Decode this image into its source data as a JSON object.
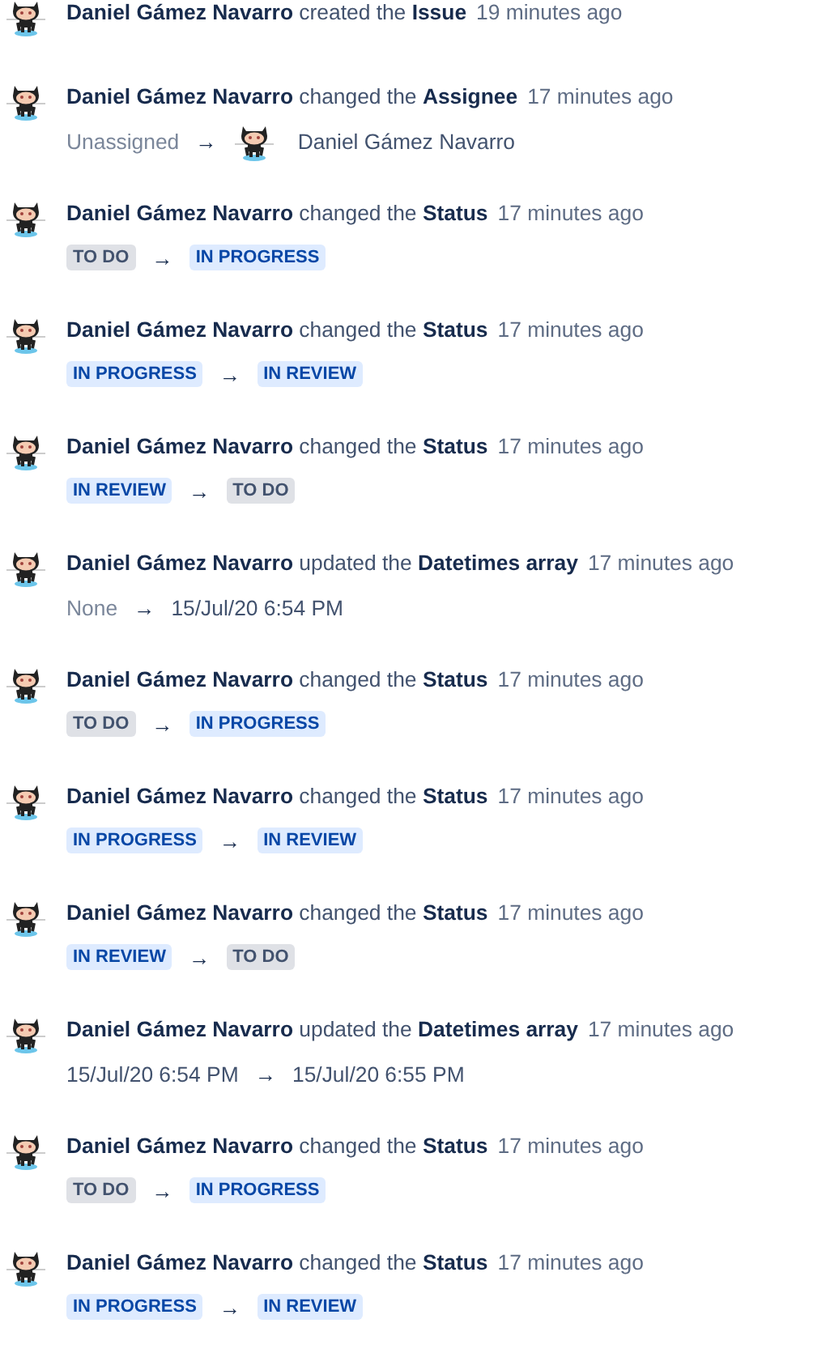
{
  "history": [
    {
      "summary": "**Daniel Gámez Navarro** created the **Issue**",
      "time": "19 minutes ago"
    },
    {
      "summary": "**Daniel Gámez Navarro** changed the **Assignee**",
      "time": "17 minutes ago",
      "from": {
        "kind": "text",
        "text": "Unassigned",
        "muted": true
      },
      "to": {
        "kind": "user",
        "text": "Daniel Gámez Navarro"
      }
    },
    {
      "summary": "**Daniel Gámez Navarro** changed the **Status**",
      "time": "17 minutes ago",
      "from": {
        "kind": "status",
        "text": "TO DO",
        "color": "#dfe1e6"
      },
      "to": {
        "kind": "status",
        "text": "IN PROGRESS",
        "color": "#deebff"
      }
    },
    {
      "summary": "**Daniel Gámez Navarro** changed the **Status**",
      "time": "17 minutes ago",
      "from": {
        "kind": "status",
        "text": "IN PROGRESS",
        "color": "#deebff"
      },
      "to": {
        "kind": "status",
        "text": "IN REVIEW",
        "color": "#deebff"
      }
    },
    {
      "summary": "**Daniel Gámez Navarro** changed the **Status**",
      "time": "17 minutes ago",
      "from": {
        "kind": "status",
        "text": "IN REVIEW",
        "color": "#deebff"
      },
      "to": {
        "kind": "status",
        "text": "TO DO",
        "color": "#dfe1e6"
      }
    },
    {
      "summary": "**Daniel Gámez Navarro** updated the **Datetimes array**",
      "time": "17 minutes ago",
      "from": {
        "kind": "text",
        "text": "None",
        "muted": true
      },
      "to": {
        "kind": "text",
        "text": "15/Jul/20 6:54 PM",
        "muted": false
      }
    },
    {
      "summary": "**Daniel Gámez Navarro** changed the **Status**",
      "time": "17 minutes ago",
      "from": {
        "kind": "status",
        "text": "TO DO",
        "color": "#dfe1e6"
      },
      "to": {
        "kind": "status",
        "text": "IN PROGRESS",
        "color": "#deebff"
      }
    },
    {
      "summary": "**Daniel Gámez Navarro** changed the **Status**",
      "time": "17 minutes ago",
      "from": {
        "kind": "status",
        "text": "IN PROGRESS",
        "color": "#deebff"
      },
      "to": {
        "kind": "status",
        "text": "IN REVIEW",
        "color": "#deebff"
      }
    },
    {
      "summary": "**Daniel Gámez Navarro** changed the **Status**",
      "time": "17 minutes ago",
      "from": {
        "kind": "status",
        "text": "IN REVIEW",
        "color": "#deebff"
      },
      "to": {
        "kind": "status",
        "text": "TO DO",
        "color": "#dfe1e6"
      }
    },
    {
      "summary": "**Daniel Gámez Navarro** updated the **Datetimes array**",
      "time": "17 minutes ago",
      "from": {
        "kind": "text",
        "text": "15/Jul/20 6:54 PM",
        "muted": false
      },
      "to": {
        "kind": "text",
        "text": "15/Jul/20 6:55 PM",
        "muted": false
      }
    },
    {
      "summary": "**Daniel Gámez Navarro** changed the **Status**",
      "time": "17 minutes ago",
      "from": {
        "kind": "status",
        "text": "TO DO",
        "color": "#dfe1e6"
      },
      "to": {
        "kind": "status",
        "text": "IN PROGRESS",
        "color": "#deebff"
      }
    },
    {
      "summary": "**Daniel Gámez Navarro** changed the **Status**",
      "time": "17 minutes ago",
      "from": {
        "kind": "status",
        "text": "IN PROGRESS",
        "color": "#deebff"
      },
      "to": {
        "kind": "status",
        "text": "IN REVIEW",
        "color": "#deebff"
      }
    }
  ],
  "arrow": "→"
}
